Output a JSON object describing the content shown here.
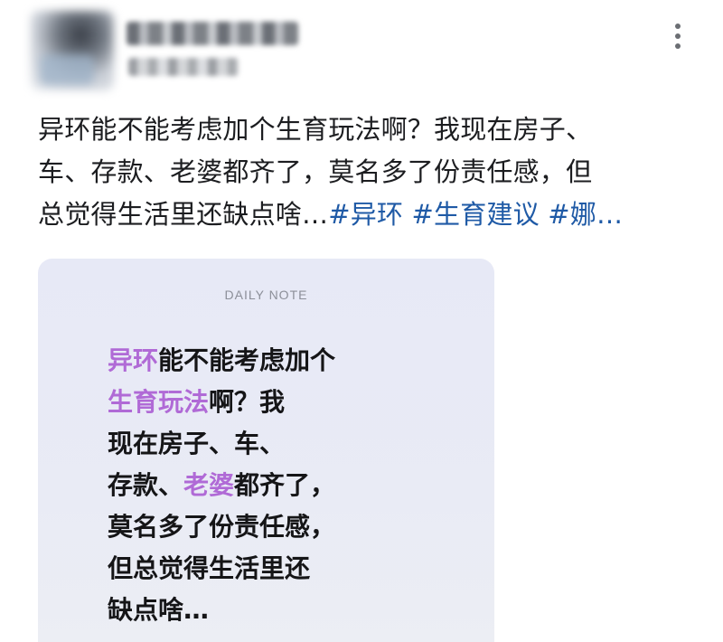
{
  "post": {
    "text_lines": [
      "异环能不能考虑加个生育玩法啊？我现在房子、",
      "车、存款、老婆都齐了，莫名多了份责任感，但",
      "总觉得生活里还缺点啥…"
    ],
    "hashtags": [
      "#异环",
      "#生育建议",
      "#娜…"
    ]
  },
  "note": {
    "label": "DAILY NOTE",
    "lines": [
      {
        "hl": "异环",
        "text": "能不能考虑加个"
      },
      {
        "hl": "生育玩法",
        "text": "啊？我"
      },
      {
        "hl": "",
        "text": "现在房子、车、"
      },
      {
        "pre": "存款、",
        "hl": "老婆",
        "text": "都齐了，"
      },
      {
        "hl": "",
        "text": "莫名多了份责任感，"
      },
      {
        "hl": "",
        "text": "但总觉得生活里还"
      },
      {
        "hl": "",
        "text": "缺点啥…"
      }
    ]
  },
  "colors": {
    "hashtag": "#1f5aa6",
    "highlight": "#b06ad6",
    "card_bg": "#e8eaf5"
  },
  "icons": {
    "more": "more-vertical-icon"
  }
}
